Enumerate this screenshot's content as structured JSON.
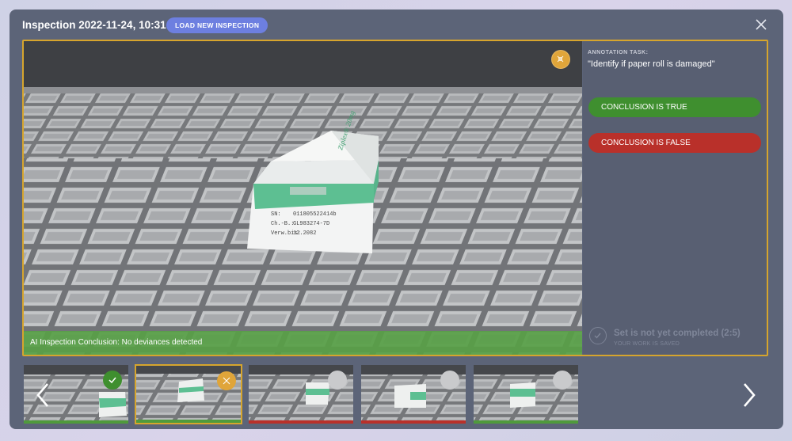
{
  "header": {
    "title": "Inspection 2022-11-24, 10:31",
    "load_button": "LOAD NEW INSPECTION",
    "close_icon": "close-icon"
  },
  "viewer": {
    "conclusion": "AI Inspection Conclusion: No deviances detected",
    "status_icon": "pending-icon",
    "product_label": {
      "brand": "Ziplex® 20mg",
      "sn_label": "SN:",
      "sn_value": "011805522414b",
      "ch_label": "Ch.-B.:",
      "ch_value": "GL983274-7D",
      "verw_label": "Verw.bis:",
      "verw_value": "12.2082"
    }
  },
  "panel": {
    "task_label": "ANNOTATION TASK:",
    "task_text": "\"Identify if paper roll is damaged\"",
    "true_button": "CONCLUSION IS TRUE",
    "false_button": "CONCLUSION IS FALSE",
    "progress_text": "Set is not yet completed (2:5)",
    "saved_text": "YOUR WORK IS SAVED"
  },
  "thumbnails": [
    {
      "status": "true",
      "icon": "check-icon",
      "bar_color": "#4f9a3c",
      "badge_color": "#3f8f2f"
    },
    {
      "status": "pending",
      "icon": "pending-icon",
      "bar_color": "#4f9a3c",
      "badge_color": "#e0a53a",
      "selected": true
    },
    {
      "status": "false",
      "icon": "empty-circle-icon",
      "bar_color": "#b9302a",
      "badge_color": "#c9cacc"
    },
    {
      "status": "false",
      "icon": "empty-circle-icon",
      "bar_color": "#b9302a",
      "badge_color": "#c9cacc"
    },
    {
      "status": "true",
      "icon": "empty-circle-icon",
      "bar_color": "#4f9a3c",
      "badge_color": "#c9cacc"
    }
  ],
  "navigation": {
    "prev_icon": "chevron-left-icon",
    "next_icon": "chevron-right-icon"
  },
  "colors": {
    "accent": "#6d7fe0",
    "selection_border": "#d6a52d",
    "true_green": "#3f8f2f",
    "false_red": "#b9302a",
    "panel_bg": "#585f72"
  }
}
